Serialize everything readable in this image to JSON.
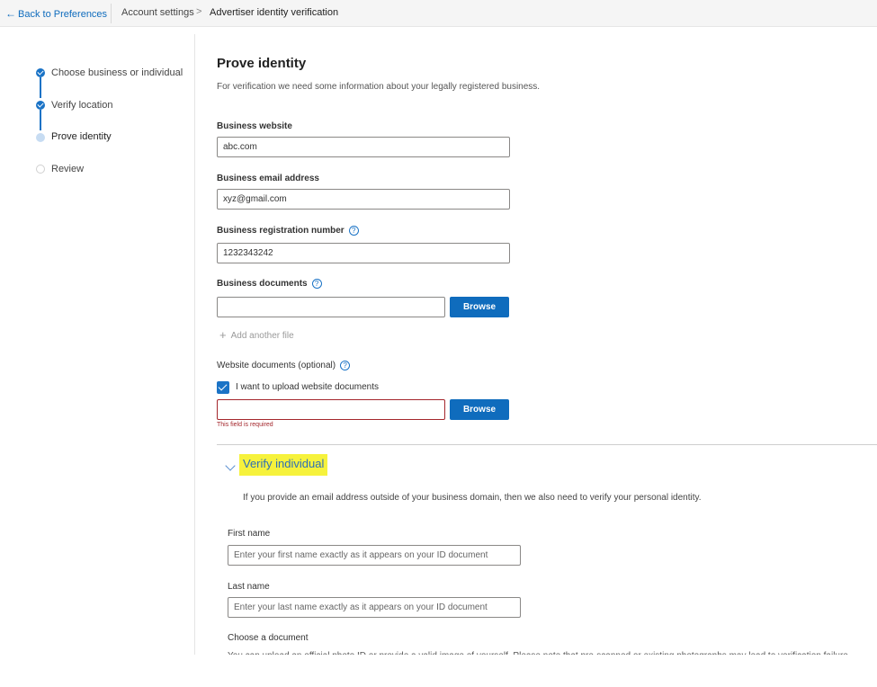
{
  "topbar": {
    "back_label": "Back to Preferences",
    "breadcrumb": [
      "Account settings",
      "Advertiser identity verification"
    ],
    "separator": ">"
  },
  "steps": [
    {
      "label": "Choose business or individual",
      "state": "completed"
    },
    {
      "label": "Verify location",
      "state": "completed"
    },
    {
      "label": "Prove identity",
      "state": "current"
    },
    {
      "label": "Review",
      "state": "pending"
    }
  ],
  "form": {
    "title": "Prove identity",
    "description": "For verification we need some information about your legally registered business.",
    "business_website": {
      "label": "Business website",
      "value": "abc.com"
    },
    "business_email": {
      "label": "Business email address",
      "value": "xyz@gmail.com"
    },
    "registration_number": {
      "label": "Business registration number",
      "value": "1232343242"
    },
    "business_documents": {
      "label": "Business documents",
      "value": "",
      "browse_label": "Browse",
      "add_another": "Add another file"
    },
    "website_documents": {
      "label": "Website documents (optional)",
      "checkbox_label": "I want to upload website documents",
      "checked": true,
      "value": "",
      "browse_label": "Browse",
      "error": "This field is required"
    }
  },
  "verify_individual": {
    "title": "Verify individual",
    "description": "If you provide an email address outside of your business domain, then we also need to verify your personal identity.",
    "first_name": {
      "label": "First name",
      "placeholder": "Enter your first name exactly as it appears on your ID document"
    },
    "last_name": {
      "label": "Last name",
      "placeholder": "Enter your last name exactly as it appears on your ID document"
    },
    "choose_document": {
      "label": "Choose a document",
      "help_text": "You can upload an official photo ID or provide a valid image of yourself. Please note that pre-scanned or existing photographs may lead to verification failure."
    }
  },
  "colors": {
    "accent": "#0f6cbd",
    "highlight": "#f6f23c",
    "error": "#a4262c",
    "link": "#2e6fb6"
  },
  "icons": {
    "back": "arrow-left-icon",
    "help": "info-circle-icon",
    "step_done": "check-circle-icon",
    "collapse": "chevron-down-icon",
    "add": "plus-icon"
  }
}
